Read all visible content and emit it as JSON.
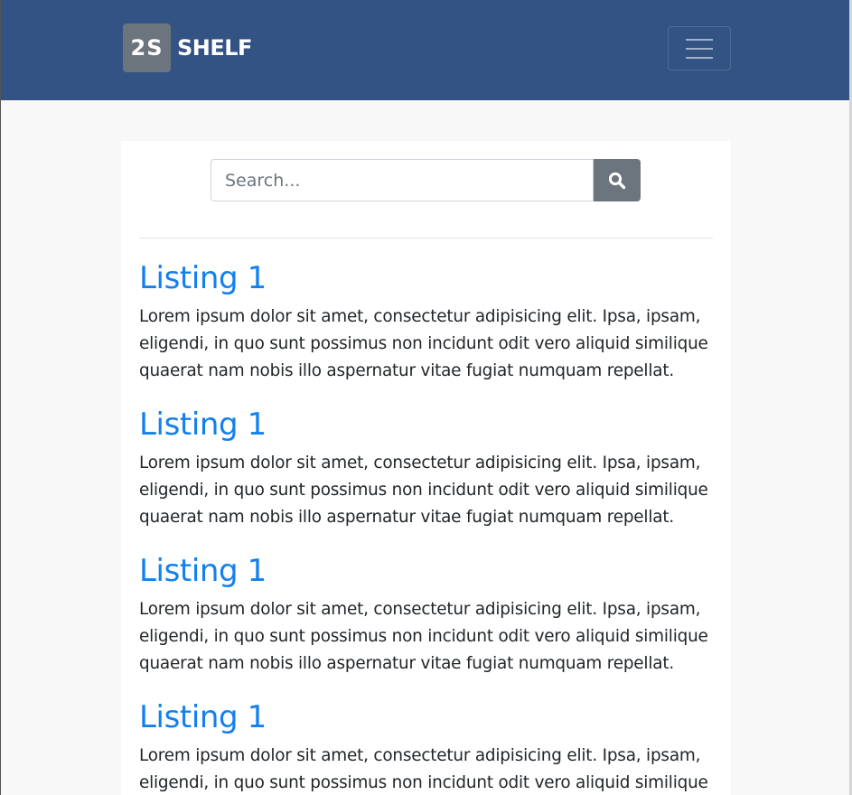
{
  "navbar": {
    "logo_text": "2S",
    "brand_name": "SHELF",
    "colors": {
      "background": "#325383",
      "logo_box": "#6c757d"
    }
  },
  "search": {
    "placeholder": "Search...",
    "button_icon": "search-icon"
  },
  "listings": [
    {
      "title": "Listing 1",
      "description": "Lorem ipsum dolor sit amet, consectetur adipisicing elit. Ipsa, ipsam, eligendi, in quo sunt possimus non incidunt odit vero aliquid similique quaerat nam nobis illo aspernatur vitae fugiat numquam repellat."
    },
    {
      "title": "Listing 1",
      "description": "Lorem ipsum dolor sit amet, consectetur adipisicing elit. Ipsa, ipsam, eligendi, in quo sunt possimus non incidunt odit vero aliquid similique quaerat nam nobis illo aspernatur vitae fugiat numquam repellat."
    },
    {
      "title": "Listing 1",
      "description": "Lorem ipsum dolor sit amet, consectetur adipisicing elit. Ipsa, ipsam, eligendi, in quo sunt possimus non incidunt odit vero aliquid similique quaerat nam nobis illo aspernatur vitae fugiat numquam repellat."
    },
    {
      "title": "Listing 1",
      "description": "Lorem ipsum dolor sit amet, consectetur adipisicing elit. Ipsa, ipsam, eligendi, in quo sunt possimus non incidunt odit vero aliquid similique quaerat nam nobis illo aspernatur vitae fugiat numquam repellat."
    }
  ],
  "colors": {
    "link": "#1380ee",
    "text": "#212529"
  }
}
